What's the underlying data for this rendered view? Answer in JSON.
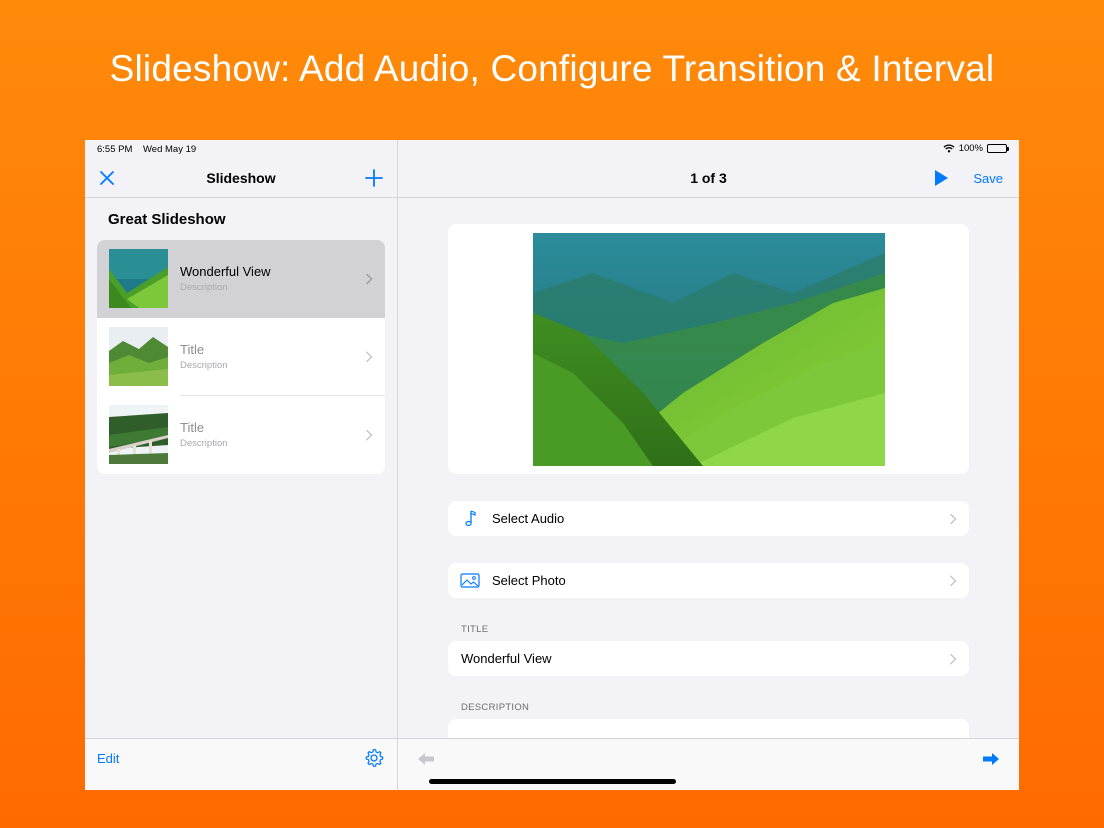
{
  "headline": "Slideshow: Add Audio, Configure Transition & Interval",
  "status_bar": {
    "time": "6:55 PM",
    "date": "Wed May 19",
    "battery": "100%"
  },
  "sidebar": {
    "nav_title": "Slideshow",
    "group_title": "Great Slideshow",
    "items": [
      {
        "title": "Wonderful View",
        "description": "Description",
        "selected": true
      },
      {
        "title": "Title",
        "description": "Description",
        "selected": false
      },
      {
        "title": "Title",
        "description": "Description",
        "selected": false
      }
    ],
    "edit_label": "Edit"
  },
  "detail": {
    "counter": "1 of 3",
    "save_label": "Save",
    "select_audio_label": "Select Audio",
    "select_photo_label": "Select Photo",
    "title_header": "TITLE",
    "title_value": "Wonderful View",
    "description_header": "DESCRIPTION"
  },
  "colors": {
    "accent": "#007aff",
    "background_top": "#ff8a0a",
    "background_bottom": "#ff6a00"
  },
  "icons": [
    "close-icon",
    "plus-icon",
    "chevron-right-icon",
    "gear-icon",
    "play-icon",
    "music-note-icon",
    "photo-icon",
    "arrow-left-icon",
    "arrow-right-icon"
  ]
}
